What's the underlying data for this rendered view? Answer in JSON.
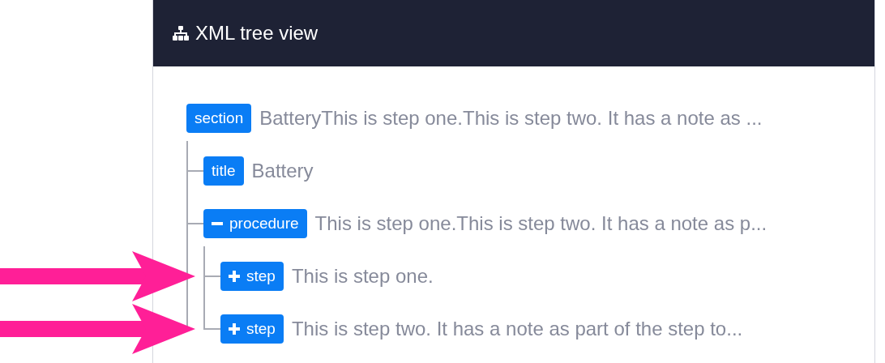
{
  "panel": {
    "title": "XML tree view"
  },
  "tree": [
    {
      "tag": "section",
      "text": "BatteryThis is step one.This is step two. It has a note as ...",
      "highlighted": false,
      "children": [
        {
          "tag": "title",
          "text": "Battery",
          "highlighted": false
        },
        {
          "tag": "procedure",
          "text": "This is step one.This is step two. It has a note as p...",
          "expanded": true,
          "highlighted": false,
          "children": [
            {
              "tag": "step",
              "text": "This is step one.",
              "expanded": false,
              "highlighted": true
            },
            {
              "tag": "step",
              "text": "This is step two. It has a note as part of the step to...",
              "expanded": false,
              "highlighted": true
            }
          ]
        }
      ]
    }
  ]
}
